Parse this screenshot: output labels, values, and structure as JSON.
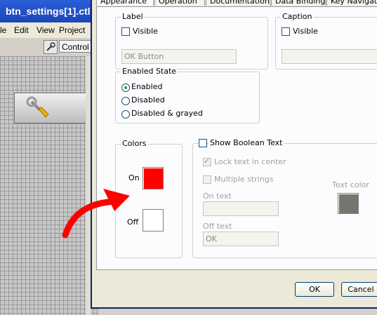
{
  "app": {
    "title": "btn_settings[1].ctl",
    "menu": [
      "le",
      "Edit",
      "View",
      "Project"
    ],
    "toolbar_control_label": "Control"
  },
  "dialog": {
    "tabs": [
      "Appearance",
      "Operation",
      "Documentation",
      "Data Binding",
      "Key Navigation"
    ],
    "label_group": {
      "title": "Label",
      "visible_label": "Visible",
      "visible_checked": false,
      "value": "OK Button"
    },
    "caption_group": {
      "title": "Caption",
      "visible_label": "Visible",
      "visible_checked": false,
      "value": ""
    },
    "enabled_state": {
      "title": "Enabled State",
      "options": [
        "Enabled",
        "Disabled",
        "Disabled & grayed"
      ],
      "selected": "Enabled"
    },
    "colors": {
      "title": "Colors",
      "on_label": "On",
      "off_label": "Off",
      "on_color": "#ff0000",
      "off_color": "#ffffff"
    },
    "boolean_text": {
      "show_label": "Show Boolean Text",
      "lock_label": "Lock text in center",
      "multiple_label": "Multiple strings",
      "on_text_label": "On text",
      "on_text_value": "",
      "off_text_label": "Off text",
      "off_text_value": "OK",
      "text_color_label": "Text color",
      "text_color": "#767570"
    },
    "buttons": {
      "ok": "OK",
      "cancel": "Cancel"
    }
  },
  "annotation": {
    "arrow_color": "#ff0000"
  }
}
